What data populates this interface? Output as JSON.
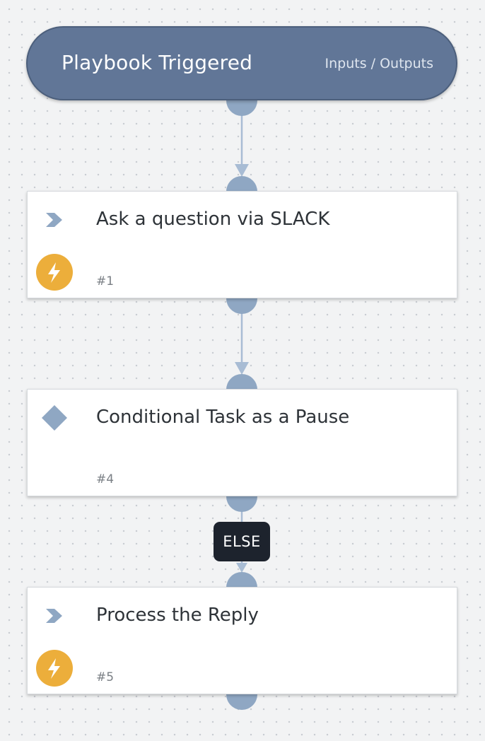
{
  "trigger": {
    "title": "Playbook Triggered",
    "io_link": "Inputs / Outputs"
  },
  "tasks": [
    {
      "title": "Ask a question via SLACK",
      "id": "#1",
      "type_icon": "chevron-right-icon",
      "badge_icon": "lightning-bolt-icon"
    },
    {
      "title": "Conditional Task as a Pause",
      "id": "#4",
      "type_icon": "diamond-icon"
    },
    {
      "title": "Process the Reply",
      "id": "#5",
      "type_icon": "chevron-right-icon",
      "badge_icon": "lightning-bolt-icon"
    }
  ],
  "edges": [
    {
      "from": "trigger",
      "to": "task-1"
    },
    {
      "from": "task-1",
      "to": "task-4"
    },
    {
      "from": "task-4",
      "to": "task-5",
      "label": "ELSE"
    }
  ],
  "colors": {
    "trigger_fill": "#617697",
    "port_and_arrow": "#8fa7c3",
    "automation_badge": "#ecae3b",
    "else_label_bg": "#1d232d"
  }
}
